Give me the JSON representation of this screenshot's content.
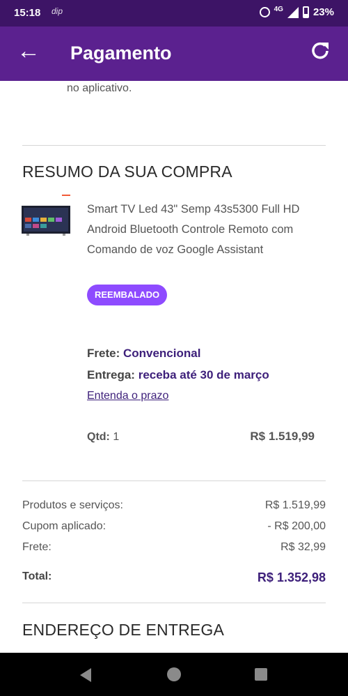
{
  "status_bar": {
    "time": "15:18",
    "carrier_glyph": "dip",
    "network": "4G",
    "battery": "23%"
  },
  "header": {
    "title": "Pagamento"
  },
  "note_text": "no aplicativo.",
  "summary": {
    "title": "RESUMO DA SUA COMPRA",
    "product_name": "Smart TV Led 43\" Semp 43s5300 Full HD Android Bluetooth Controle Remoto com Comando de voz Google Assistant",
    "badge": "REEMBALADO",
    "frete_label": "Frete:",
    "frete_value": "Convencional",
    "entrega_label": "Entrega:",
    "entrega_value": "receba até 30 de março",
    "prazo_link": "Entenda o prazo",
    "qty_label": "Qtd:",
    "qty_value": "1",
    "price": "R$ 1.519,99"
  },
  "totals": {
    "rows": [
      {
        "label": "Produtos e serviços:",
        "value": "R$ 1.519,99"
      },
      {
        "label": "Cupom aplicado:",
        "value": "- R$ 200,00"
      },
      {
        "label": "Frete:",
        "value": "R$ 32,99"
      }
    ],
    "total_label": "Total:",
    "total_value": "R$ 1.352,98"
  },
  "address": {
    "title": "ENDEREÇO DE ENTREGA"
  },
  "colors": {
    "header": "#5b218f",
    "status_bar": "#3d1466",
    "accent": "#3d1f7a",
    "badge": "#8e4bff"
  }
}
